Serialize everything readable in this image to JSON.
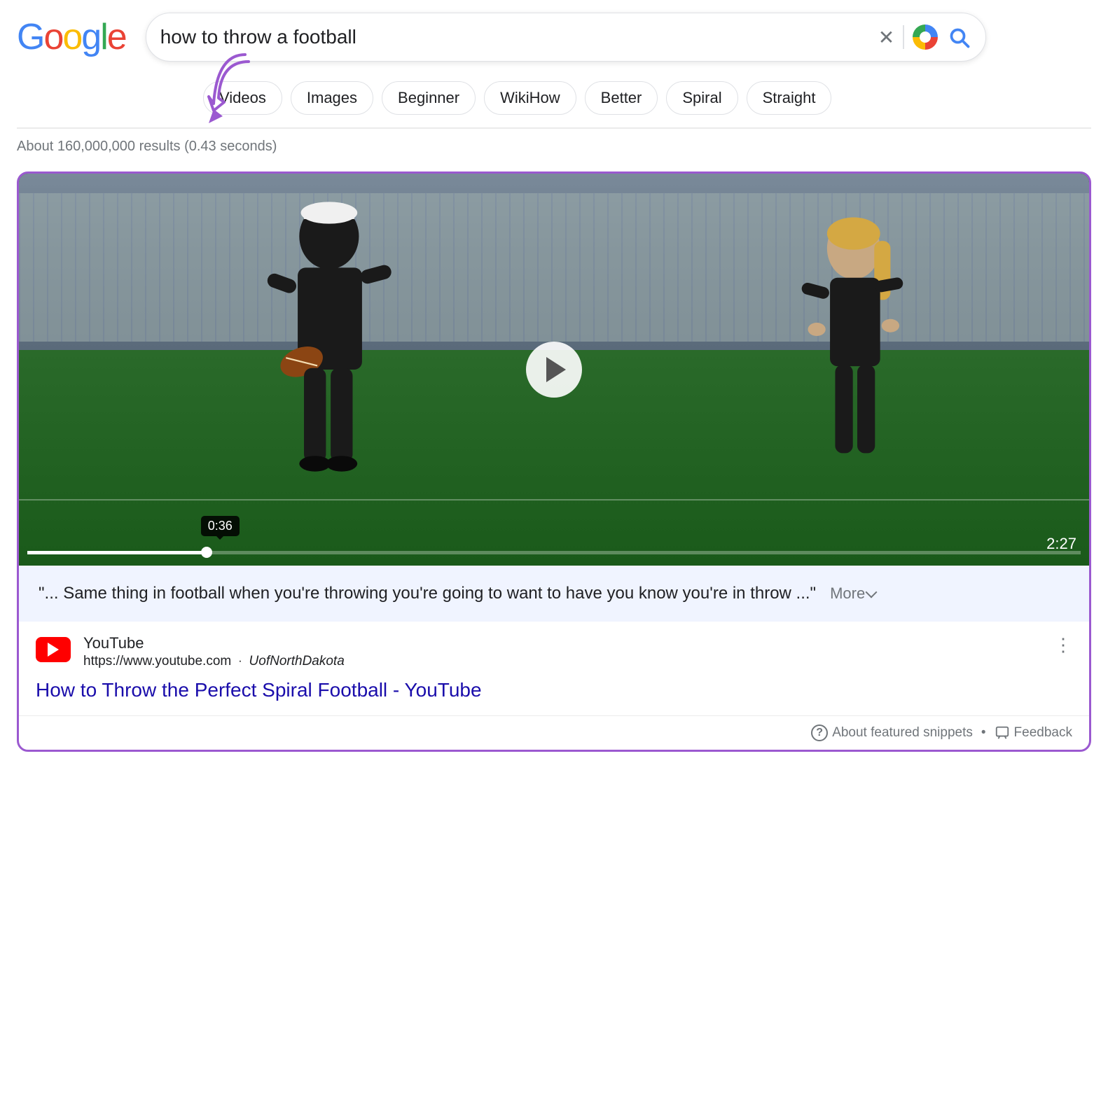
{
  "header": {
    "logo": {
      "g1": "G",
      "o1": "o",
      "o2": "o",
      "g2": "g",
      "l": "l",
      "e": "e"
    },
    "search": {
      "query": "how to throw a football",
      "clear_label": "×",
      "search_label": "Search"
    }
  },
  "chips": {
    "items": [
      {
        "label": "Videos"
      },
      {
        "label": "Images"
      },
      {
        "label": "Beginner"
      },
      {
        "label": "WikiHow"
      },
      {
        "label": "Better"
      },
      {
        "label": "Spiral"
      },
      {
        "label": "Straight"
      }
    ]
  },
  "results": {
    "count_text": "About 160,000,000 results (0.43 seconds)"
  },
  "featured_snippet": {
    "video": {
      "time_tooltip": "0:36",
      "duration": "2:27"
    },
    "transcript": {
      "text": "\"... Same thing in football when you're throwing you're going to want to have you know you're in throw ...\"",
      "more_label": "More"
    },
    "source": {
      "name": "YouTube",
      "url": "https://www.youtube.com",
      "author": "UofNorthDakota",
      "title": "How to Throw the Perfect Spiral Football - YouTube"
    },
    "footer": {
      "about_label": "About featured snippets",
      "feedback_label": "Feedback"
    }
  },
  "arrow": {
    "label": "annotation arrow"
  }
}
